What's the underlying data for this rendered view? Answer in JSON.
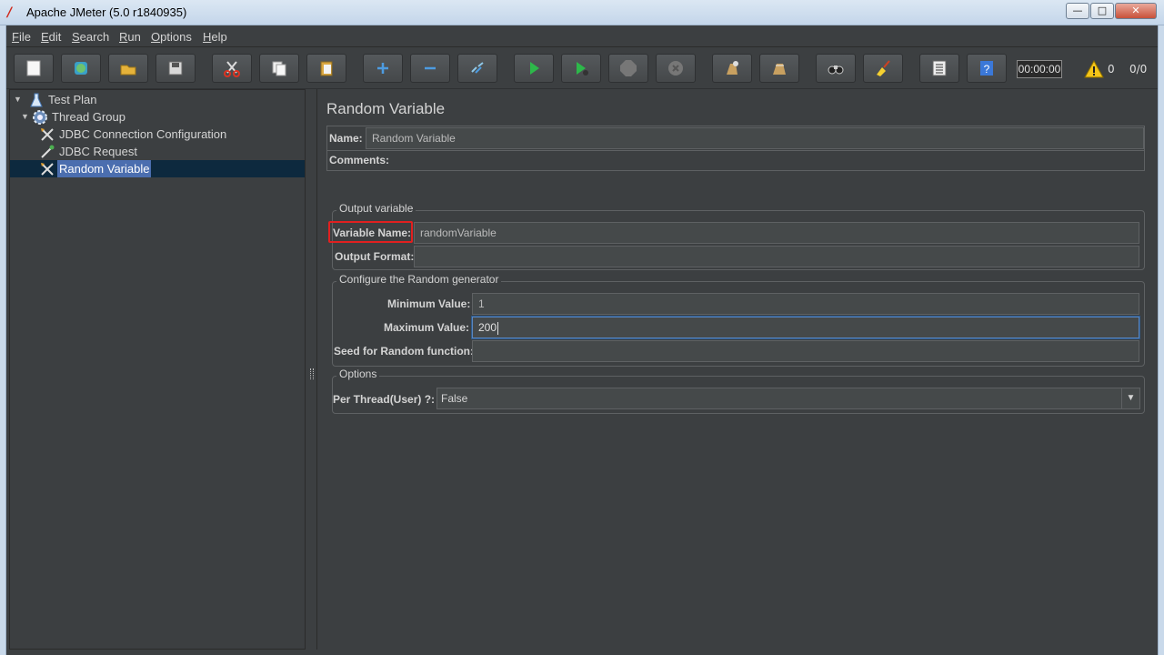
{
  "window": {
    "title": "Apache JMeter (5.0 r1840935)",
    "minimize": "—",
    "maximize": "□",
    "close": "✕"
  },
  "menu": [
    {
      "label": "File",
      "mnemonic": "F",
      "rest": "ile"
    },
    {
      "label": "Edit",
      "mnemonic": "E",
      "rest": "dit"
    },
    {
      "label": "Search",
      "mnemonic": "S",
      "rest": "earch"
    },
    {
      "label": "Run",
      "mnemonic": "R",
      "rest": "un"
    },
    {
      "label": "Options",
      "mnemonic": "O",
      "rest": "ptions"
    },
    {
      "label": "Help",
      "mnemonic": "H",
      "rest": "elp"
    }
  ],
  "toolbar": {
    "icons": [
      "new-icon",
      "templates-icon",
      "open-icon",
      "save-icon",
      "cut-icon",
      "copy-icon",
      "paste-icon",
      "expand-icon",
      "collapse-icon",
      "toggle-icon",
      "start-icon",
      "start-no-pauses-icon",
      "stop-icon",
      "shutdown-icon",
      "clear-icon",
      "clear-all-icon",
      "search-icon",
      "reset-search-icon",
      "function-helper-icon",
      "help-icon"
    ],
    "timer": "00:00:00",
    "warnings": "0",
    "threads": "0/0"
  },
  "tree": [
    {
      "label": "Test Plan",
      "icon": "test-plan-icon",
      "depth": 0,
      "expanded": true
    },
    {
      "label": "Thread Group",
      "icon": "thread-group-icon",
      "depth": 1,
      "expanded": true
    },
    {
      "label": "JDBC Connection Configuration",
      "icon": "config-element-icon",
      "depth": 2
    },
    {
      "label": "JDBC Request",
      "icon": "sampler-icon",
      "depth": 2
    },
    {
      "label": "Random Variable",
      "icon": "config-element-icon",
      "depth": 2,
      "selected": true
    }
  ],
  "panel": {
    "title": "Random Variable",
    "name_label": "Name:",
    "name_value": "Random Variable",
    "comments_label": "Comments:",
    "output_group": "Output variable",
    "variable_name_label": "Variable Name:",
    "variable_name_value": "randomVariable",
    "output_format_label": "Output Format:",
    "output_format_value": "",
    "random_group": "Configure the Random generator",
    "min_label": "Minimum Value:",
    "min_value": "1",
    "max_label": "Maximum Value:",
    "max_value": "200",
    "seed_label": "Seed for Random function:",
    "seed_value": "",
    "options_group": "Options",
    "per_thread_label": "Per Thread(User) ?:",
    "per_thread_value": "False"
  },
  "colors": {
    "background": "#3c3f41",
    "field": "#45494a",
    "selection": "#4b6eaf",
    "highlight_box": "#e02020"
  }
}
